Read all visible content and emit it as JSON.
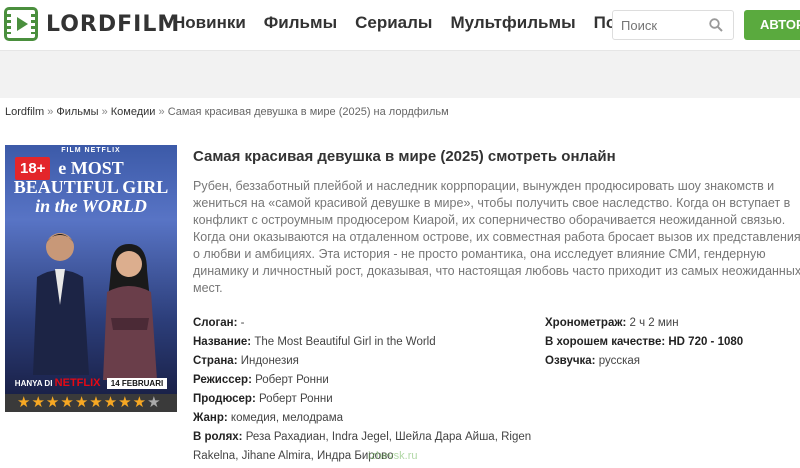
{
  "header": {
    "logo_text": "LORDFILM",
    "nav": [
      "Новинки",
      "Фильмы",
      "Сериалы",
      "Мультфильмы",
      "Подборки"
    ],
    "search_placeholder": "Поиск",
    "auth_label": "АВТОР"
  },
  "breadcrumb": {
    "items": [
      "Lordfilm",
      "Фильмы",
      "Комедии"
    ],
    "current": "Самая красивая девушка в мире (2025) на лордфильм",
    "separator": "»"
  },
  "poster": {
    "top_label": "FILM NETFLIX",
    "age_rating": "18+",
    "title_line1": "e MOST",
    "title_line2": "BEAUTIFUL GIRL",
    "title_line3": "in the WORLD",
    "bottom_prefix": "HANYA DI",
    "bottom_brand": "NETFLIX",
    "bottom_date": "14 FEBRUARI"
  },
  "rating": {
    "stars_filled": 9,
    "stars_total": 10
  },
  "film": {
    "title": "Самая красивая девушка в мире (2025) смотреть онлайн",
    "description": "Рубен, беззаботный плейбой и наследник коррпорации, вынужден продюсировать шоу знакомств и жениться на «самой красивой девушке в мире», чтобы получить свое наследство. Когда он вступает в конфликт с остроумным продюсером Киарой, их соперничество оборачивается неожиданной связью. Когда они оказываются на отдаленном острове, их совместная работа бросает вызов их представлениям о любви и амбициях. Эта история - не просто романтика, она исследует влияние СМИ, гендерную динамику и личностный рост, доказывая, что настоящая любовь часто приходит из самых неожиданных мест."
  },
  "meta_left": [
    {
      "label": "Слоган:",
      "value": " -"
    },
    {
      "label": "Название:",
      "value": " The Most Beautiful Girl in the World"
    },
    {
      "label": "Страна:",
      "value": " Индонезия"
    },
    {
      "label": "Режиссер:",
      "value": " Роберт Ронни"
    },
    {
      "label": "Продюсер:",
      "value": " Роберт Ронни"
    },
    {
      "label": "Жанр:",
      "value": " комедия, мелодрама"
    },
    {
      "label": "В ролях:",
      "value": " Реза Рахадиан, Indra Jegel, Шейла Дара Айша, Rigen Rakelna, Jihane Almira, Индра Бирово"
    }
  ],
  "meta_right": [
    {
      "label": "Хронометраж:",
      "value": " 2 ч 2 мин"
    },
    {
      "label": "В хорошем качестве:",
      "value": " HD 720 - 1080"
    },
    {
      "label": "Озвучка:",
      "value": " русская"
    }
  ],
  "watermark": "izhevsk.ru",
  "colors": {
    "accent_green": "#5aaa3e",
    "age_badge": "#e3262a",
    "star": "#f7a823"
  }
}
